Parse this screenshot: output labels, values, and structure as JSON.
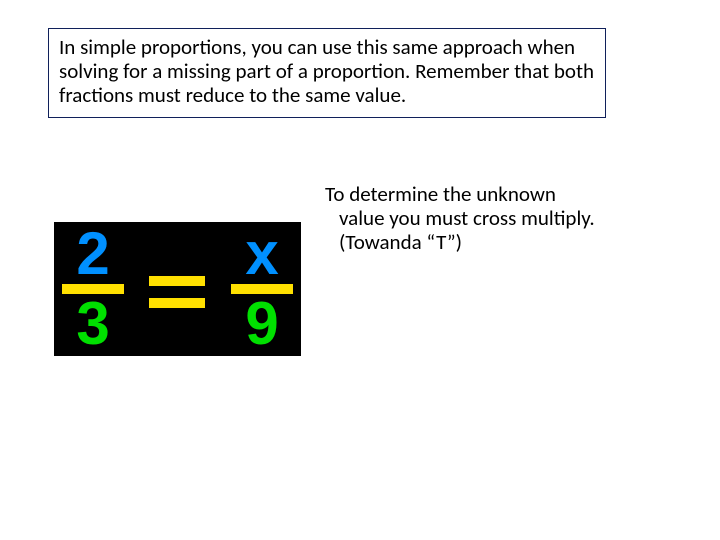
{
  "intro_box": "In simple proportions, you can use this same approach when solving for a missing part of a proportion. Remember that both fractions must reduce to the same value.",
  "body": {
    "line1": "To determine the unknown",
    "line2": "value you must cross multiply.",
    "line3": "(Towanda “T”)"
  },
  "equation": {
    "left_numerator": "2",
    "left_denominator": "3",
    "right_numerator": "x",
    "right_denominator": "9"
  }
}
